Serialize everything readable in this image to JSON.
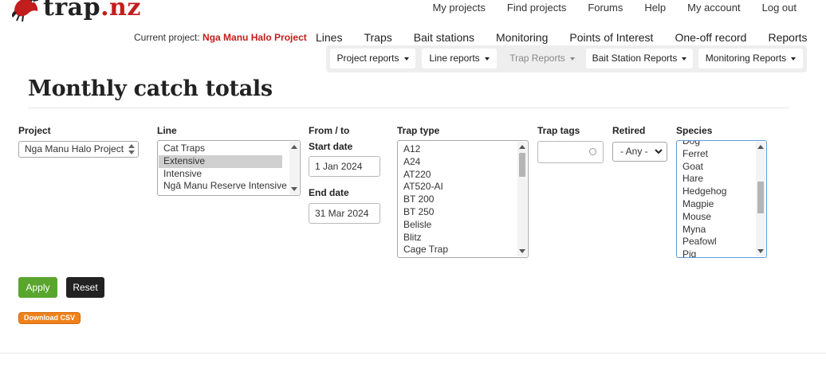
{
  "brand": {
    "name_main": "trap",
    "name_tld": ".nz",
    "logo_red": "#c21d1d"
  },
  "topnav": [
    "My projects",
    "Find projects",
    "Forums",
    "Help",
    "My account",
    "Log out"
  ],
  "current_project": {
    "prefix": "Current project:",
    "name": "Nga Manu Halo Project"
  },
  "mainnav": [
    "Lines",
    "Traps",
    "Bait stations",
    "Monitoring",
    "Points of Interest",
    "One-off record",
    "Reports"
  ],
  "subnav": [
    {
      "label": "Project reports",
      "disabled": false
    },
    {
      "label": "Line reports",
      "disabled": false
    },
    {
      "label": "Trap Reports",
      "disabled": true
    },
    {
      "label": "Bait Station Reports",
      "disabled": false
    },
    {
      "label": "Monitoring Reports",
      "disabled": false
    }
  ],
  "page_title": "Monthly catch totals",
  "form": {
    "project": {
      "label": "Project",
      "value": "Nga Manu Halo Project"
    },
    "line": {
      "label": "Line",
      "options": [
        "Cat Traps",
        "Extensive",
        "Intensive",
        "Ngā Manu Reserve Intensive"
      ],
      "selected": "Extensive"
    },
    "from_to": {
      "label": "From / to",
      "start_label": "Start date",
      "start_value": "1 Jan 2024",
      "end_label": "End date",
      "end_value": "31 Mar 2024"
    },
    "trap_type": {
      "label": "Trap type",
      "options": [
        "A12",
        "A24",
        "AT220",
        "AT520-AI",
        "BT 200",
        "BT 250",
        "Belisle",
        "Blitz",
        "Cage Trap"
      ]
    },
    "trap_tags": {
      "label": "Trap tags",
      "value": ""
    },
    "retired": {
      "label": "Retired",
      "value": "- Any -"
    },
    "species": {
      "label": "Species",
      "options": [
        "Dog",
        "Ferret",
        "Goat",
        "Hare",
        "Hedgehog",
        "Magpie",
        "Mouse",
        "Myna",
        "Peafowl",
        "Pig"
      ]
    }
  },
  "buttons": {
    "apply": "Apply",
    "reset": "Reset",
    "download_csv": "Download CSV"
  },
  "colors": {
    "apply": "#5aa52e",
    "reset": "#222222",
    "csv": "#f0811b",
    "accent_red": "#c21d1d",
    "focus_border": "#5b9dd9"
  }
}
